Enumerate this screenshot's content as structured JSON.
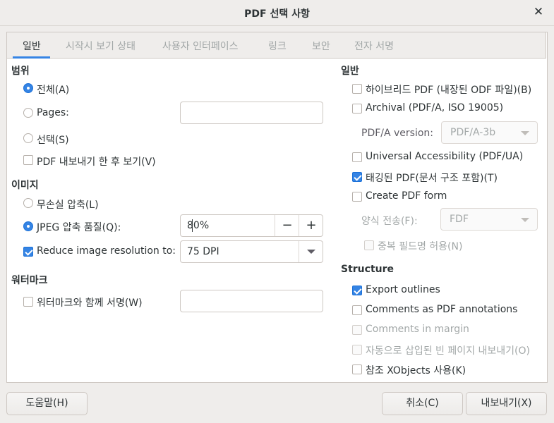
{
  "window": {
    "title": "PDF 선택 사항"
  },
  "tabs": [
    {
      "label": "일반"
    },
    {
      "label": "시작시 보기 상태"
    },
    {
      "label": "사용자 인터페이스"
    },
    {
      "label": "링크"
    },
    {
      "label": "보안"
    },
    {
      "label": "전자 서명"
    }
  ],
  "range": {
    "heading": "범위",
    "all": "전체(A)",
    "pages": "Pages:",
    "pages_value": "",
    "selection": "선택(S)",
    "view_after": "PDF 내보내기 한 후 보기(V)"
  },
  "images": {
    "heading": "이미지",
    "lossless": "무손실 압축(L)",
    "jpeg": "JPEG 압축  품질(Q):",
    "jpeg_quality": "80%",
    "reduce": "Reduce image resolution to:",
    "resolution": "75 DPI",
    "minus": "−",
    "plus": "+"
  },
  "watermark": {
    "heading": "워터마크",
    "sign": "워터마크와 함께 서명(W)",
    "value": ""
  },
  "general": {
    "heading": "일반",
    "hybrid": "하이브리드 PDF (내장된 ODF 파일)(B)",
    "archival": "Archival (PDF/A, ISO 19005)",
    "pdfa_version_label": "PDF/A version:",
    "pdfa_version": "PDF/A-3b",
    "universal": "Universal Accessibility (PDF/UA)",
    "tagged": "태깅된 PDF(문서 구조 포함)(T)",
    "create_form": "Create PDF form",
    "submit_label": "양식 전송(F):",
    "submit_format": "FDF",
    "duplicate": "중복 필드명 허용(N)"
  },
  "structure": {
    "heading": "Structure",
    "export_outlines": "Export outlines",
    "comments_annot": "Comments as PDF annotations",
    "comments_margin": "Comments in margin",
    "blank_pages": "자동으로 삽입된 빈 페이지 내보내기(O)",
    "xobjects": "참조 XObjects 사용(K)"
  },
  "buttons": {
    "help": "도움말(H)",
    "cancel": "취소(C)",
    "export": "내보내기(X)"
  },
  "colors": {
    "accent": "#3584e4"
  }
}
